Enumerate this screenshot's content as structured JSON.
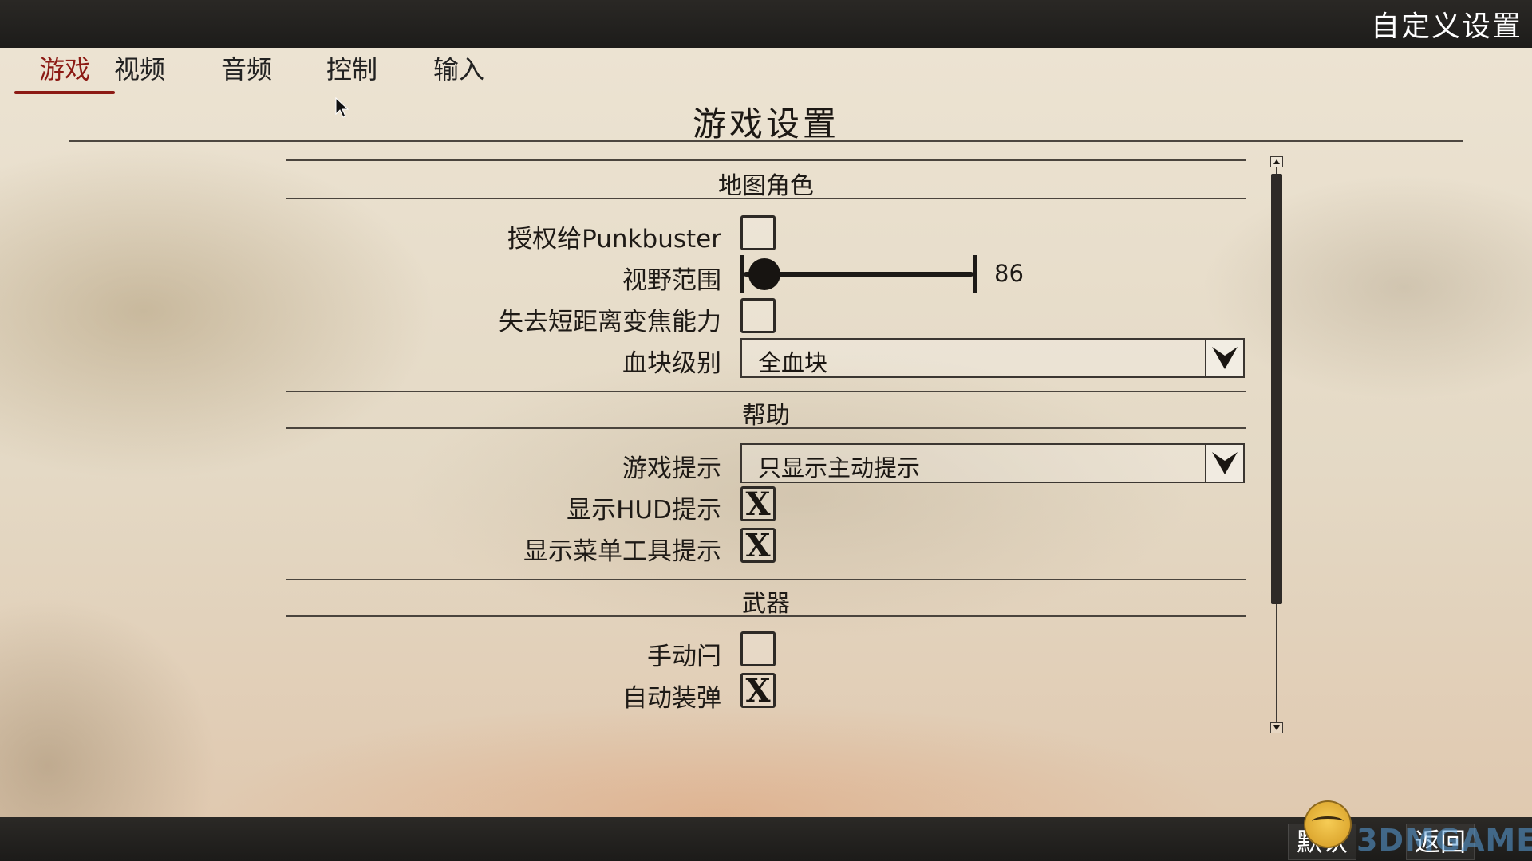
{
  "window": {
    "title": "自定义设置"
  },
  "tabs": [
    {
      "label": "游戏",
      "active": true
    },
    {
      "label": "视频",
      "active": false
    },
    {
      "label": "音频",
      "active": false
    },
    {
      "label": "控制",
      "active": false
    },
    {
      "label": "输入",
      "active": false
    }
  ],
  "page_title": "游戏设置",
  "sections": {
    "map_character": {
      "title": "地图角色",
      "punkbuster": {
        "label": "授权给Punkbuster",
        "checked": false
      },
      "fov": {
        "label": "视野范围",
        "value": "86"
      },
      "short_zoom": {
        "label": "失去短距离变焦能力",
        "checked": false
      },
      "health_level": {
        "label": "血块级别",
        "selected": "全血块",
        "icon": "chevron-down-icon"
      }
    },
    "help": {
      "title": "帮助",
      "game_hints": {
        "label": "游戏提示",
        "selected": "只显示主动提示",
        "icon": "chevron-down-icon"
      },
      "hud_hints": {
        "label": "显示HUD提示",
        "checked": true,
        "mark": "X"
      },
      "menu_tooltips": {
        "label": "显示菜单工具提示",
        "checked": true,
        "mark": "X"
      }
    },
    "weapons": {
      "title": "武器",
      "manual_bolt": {
        "label": "手动闩",
        "checked": false
      },
      "auto_reload": {
        "label": "自动装弹",
        "checked": true,
        "mark": "X"
      }
    }
  },
  "footer": {
    "default_label": "默认",
    "back_label": "返回",
    "watermark": "3DMGAME"
  },
  "colors": {
    "accent": "#8c1a14",
    "bar": "#1d1c1a",
    "paper": "#e6dccb"
  }
}
